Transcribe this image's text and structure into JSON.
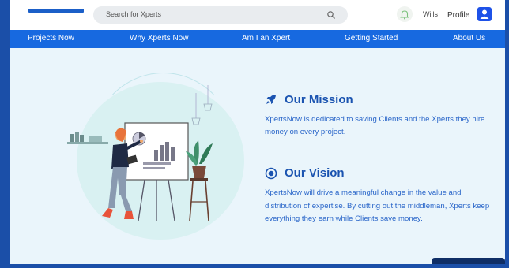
{
  "header": {
    "search_placeholder": "Search for Xperts",
    "user_name": "Wills",
    "profile_label": "Profile"
  },
  "nav": {
    "items": [
      {
        "label": "Projects Now"
      },
      {
        "label": "Why Xperts Now"
      },
      {
        "label": "Am I an Xpert"
      },
      {
        "label": "Getting Started"
      },
      {
        "label": "About Us"
      }
    ]
  },
  "mission": {
    "icon": "rocket-icon",
    "title": "Our Mission",
    "text": "XpertsNow is dedicated to saving Clients and the Xperts they hire money on every project."
  },
  "vision": {
    "icon": "target-icon",
    "title": "Our Vision",
    "text": "XpertsNow will drive a meaningful change in the value and distribution of expertise. By cutting out the middleman, Xperts keep everything they earn while Clients save money."
  },
  "colors": {
    "accent": "#1769e0",
    "frame": "#1b4fa8",
    "background": "#eaf5fb",
    "heading": "#1a53b0"
  }
}
